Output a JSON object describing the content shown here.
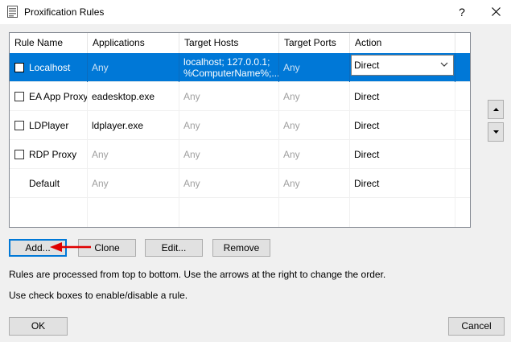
{
  "window": {
    "title": "Proxification Rules",
    "help_label": "?",
    "close_label": "✕"
  },
  "table": {
    "columns": [
      "Rule Name",
      "Applications",
      "Target Hosts",
      "Target Ports",
      "Action"
    ],
    "rows": [
      {
        "checked": false,
        "has_checkbox": true,
        "selected": true,
        "name": "Localhost",
        "applications": "Any",
        "hosts": [
          "localhost; 127.0.0.1;",
          "%ComputerName%;..."
        ],
        "ports": "Any",
        "action": "Direct"
      },
      {
        "checked": false,
        "has_checkbox": true,
        "selected": false,
        "name": "EA App Proxy",
        "applications": "eadesktop.exe",
        "hosts": [
          "Any"
        ],
        "ports": "Any",
        "action": "Direct"
      },
      {
        "checked": false,
        "has_checkbox": true,
        "selected": false,
        "name": "LDPlayer",
        "applications": "ldplayer.exe",
        "hosts": [
          "Any"
        ],
        "ports": "Any",
        "action": "Direct"
      },
      {
        "checked": false,
        "has_checkbox": true,
        "selected": false,
        "name": "RDP Proxy",
        "applications": "Any",
        "hosts": [
          "Any"
        ],
        "ports": "Any",
        "action": "Direct"
      },
      {
        "checked": false,
        "has_checkbox": false,
        "selected": false,
        "name": "Default",
        "applications": "Any",
        "hosts": [
          "Any"
        ],
        "ports": "Any",
        "action": "Direct"
      }
    ]
  },
  "buttons": {
    "add": "Add...",
    "clone": "Clone",
    "edit": "Edit...",
    "remove": "Remove",
    "ok": "OK",
    "cancel": "Cancel"
  },
  "info": {
    "line1": "Rules are processed from top to bottom. Use the arrows at the right to change the order.",
    "line2": "Use check boxes to enable/disable a rule."
  },
  "icons": {
    "move_up": "triangle-up-icon",
    "move_down": "triangle-down-icon",
    "annotation": "red-arrow-icon"
  },
  "colors": {
    "selection": "#0078d7",
    "annotation": "#e00000"
  }
}
